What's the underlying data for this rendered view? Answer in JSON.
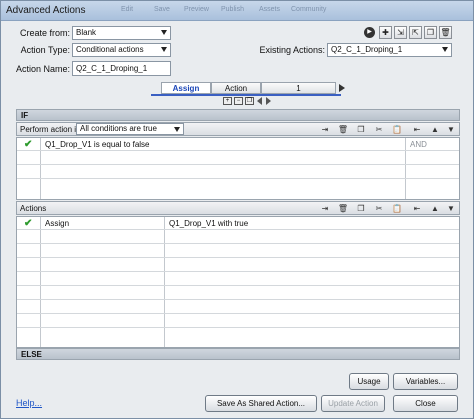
{
  "window": {
    "title": "Advanced Actions",
    "ghost_menu": [
      "Edit",
      "Save",
      "Preview",
      "Publish",
      "Assets",
      "Community"
    ]
  },
  "form": {
    "create_from_label": "Create from:",
    "create_from_value": "Blank",
    "action_type_label": "Action Type:",
    "action_type_value": "Conditional actions",
    "action_name_label": "Action Name:",
    "action_name_value": "Q2_C_1_Droping_1",
    "existing_actions_label": "Existing Actions:",
    "existing_actions_value": "Q2_C_1_Droping_1"
  },
  "tabs": {
    "assign": "Assign",
    "action": "Action",
    "count": "1"
  },
  "if_section": {
    "label": "IF",
    "perform_label": "Perform action if:",
    "condition_mode": "All conditions are true",
    "rows": [
      {
        "checked": true,
        "text": "Q1_Drop_V1   is equal to    false",
        "operator": "AND"
      }
    ]
  },
  "actions_section": {
    "label": "Actions",
    "rows": [
      {
        "checked": true,
        "action": "Assign",
        "target": "Q1_Drop_V1    with    true"
      }
    ]
  },
  "else_section": {
    "label": "ELSE"
  },
  "buttons": {
    "usage": "Usage",
    "variables": "Variables...",
    "help": "Help...",
    "save_shared": "Save As Shared Action...",
    "update": "Update Action",
    "close": "Close"
  },
  "colors": {
    "accent": "#3a5fc2",
    "check": "#2e9b2e",
    "link": "#1f56c7"
  }
}
